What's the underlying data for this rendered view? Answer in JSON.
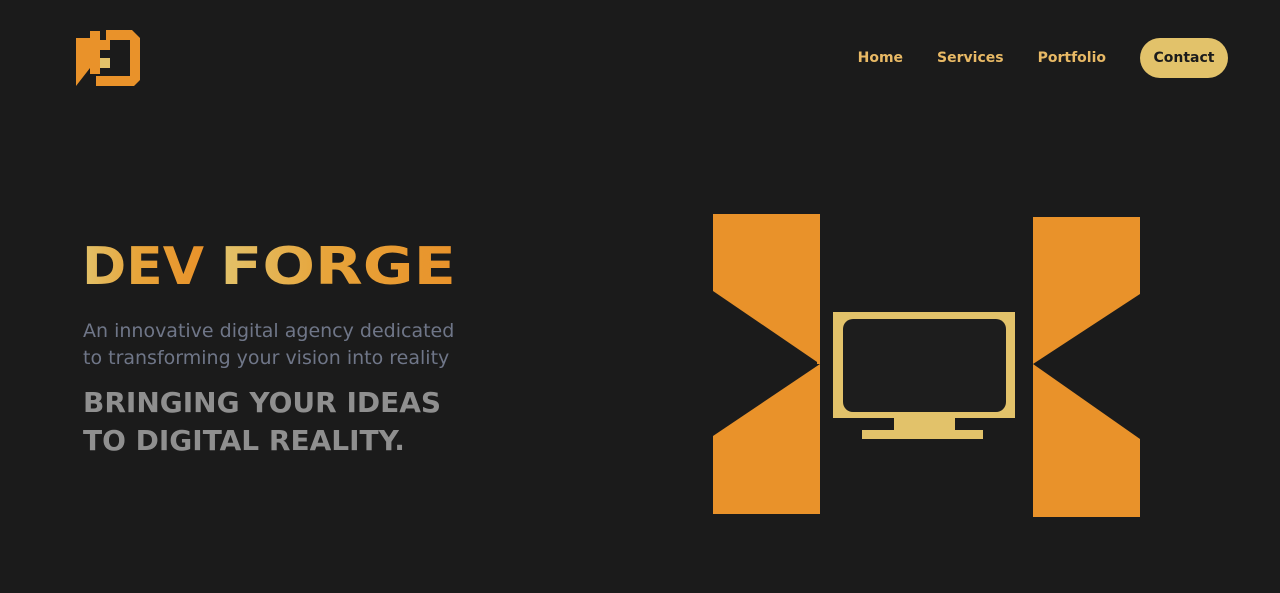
{
  "brand": {
    "logo_icon": "df-monogram-logo",
    "wordmark_left": "DEV",
    "wordmark_right": "FORGE",
    "colors": {
      "orange": "#e9922a",
      "gold": "#e2c26a",
      "background": "#1b1b1b"
    }
  },
  "nav": {
    "items": [
      {
        "label": "Home"
      },
      {
        "label": "Services"
      },
      {
        "label": "Portfolio"
      }
    ],
    "cta_label": "Contact"
  },
  "hero": {
    "tagline_line1": "An innovative digital agency dedicated",
    "tagline_line2": "to transforming your vision into reality",
    "headline_line1": "BRINGING YOUR IDEAS",
    "headline_line2": "TO DIGITAL REALITY.",
    "illustration_icon": "monitor-between-chevrons-illustration"
  }
}
